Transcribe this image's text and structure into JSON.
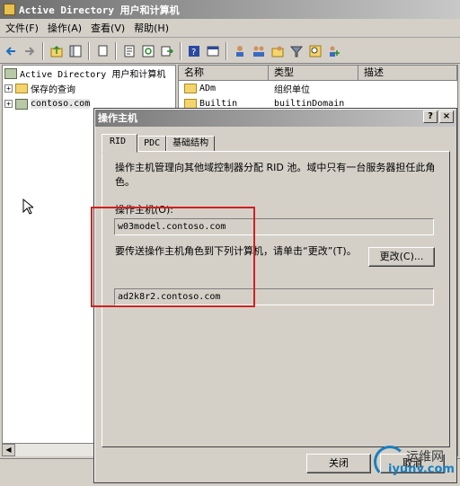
{
  "window": {
    "title": "Active Directory 用户和计算机"
  },
  "menu": [
    "文件(F)",
    "操作(A)",
    "查看(V)",
    "帮助(H)"
  ],
  "toolbar_icons": [
    "back-icon",
    "forward-icon",
    "up-folder-icon",
    "show-tree-icon",
    "copy-icon",
    "properties-icon",
    "refresh-icon",
    "export-list-icon",
    "help-icon",
    "console-icon",
    "user-icon",
    "group-icon",
    "ou-icon",
    "filter-icon",
    "find-icon",
    "add-member-icon"
  ],
  "tree": {
    "root": "Active Directory 用户和计算机",
    "items": [
      {
        "label": "保存的查询",
        "expander": "+"
      },
      {
        "label": "contoso.com",
        "expander": "+"
      }
    ]
  },
  "list": {
    "columns": [
      "名称",
      "类型",
      "描述"
    ],
    "rows": [
      {
        "name": "ADm",
        "type": "组织单位",
        "desc": ""
      },
      {
        "name": "Builtin",
        "type": "builtinDomain",
        "desc": ""
      }
    ]
  },
  "dialog": {
    "title": "操作主机",
    "help_btn": "?",
    "close_btn": "×",
    "tabs": [
      "RID",
      "PDC",
      "基础结构"
    ],
    "description": "操作主机管理向其他域控制器分配 RID 池。域中只有一台服务器担任此角色。",
    "master_label": "操作主机(O):",
    "master_value": "w03model.contoso.com",
    "transfer_label": "要传送操作主机角色到下列计算机，请单击“更改”(T)。",
    "change_btn": "更改(C)...",
    "target_value": "ad2k8r2.contoso.com",
    "close_label": "关闭",
    "cancel_label": "取消"
  },
  "watermark": {
    "line1": "运维网",
    "line2": "iyunv.com"
  },
  "colors": {
    "highlight": "#d02020",
    "watermark": "#1a7fc0"
  }
}
